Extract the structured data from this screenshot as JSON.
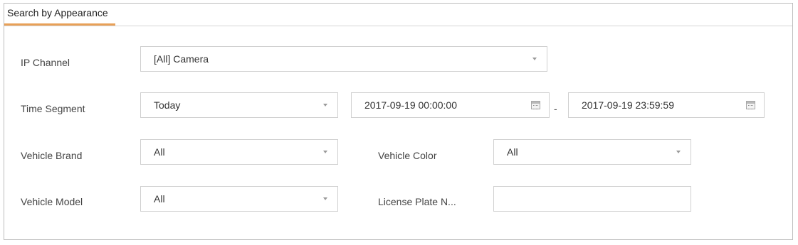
{
  "tab": {
    "title": "Search by Appearance"
  },
  "rows": {
    "ip_channel": {
      "label": "IP Channel",
      "value": "[All] Camera"
    },
    "time_segment": {
      "label": "Time Segment",
      "value": "Today",
      "start": "2017-09-19 00:00:00",
      "separator": "-",
      "end": "2017-09-19 23:59:59"
    },
    "vehicle_brand": {
      "label": "Vehicle Brand",
      "value": "All"
    },
    "vehicle_color": {
      "label": "Vehicle Color",
      "value": "All"
    },
    "vehicle_model": {
      "label": "Vehicle Model",
      "value": "All"
    },
    "license_plate": {
      "label": "License Plate N...",
      "value": ""
    }
  },
  "icons": {
    "dropdown": "chevron-down-icon",
    "calendar": "calendar-icon"
  },
  "colors": {
    "tab_accent": "#e8a057",
    "border": "#d0d0d0"
  }
}
